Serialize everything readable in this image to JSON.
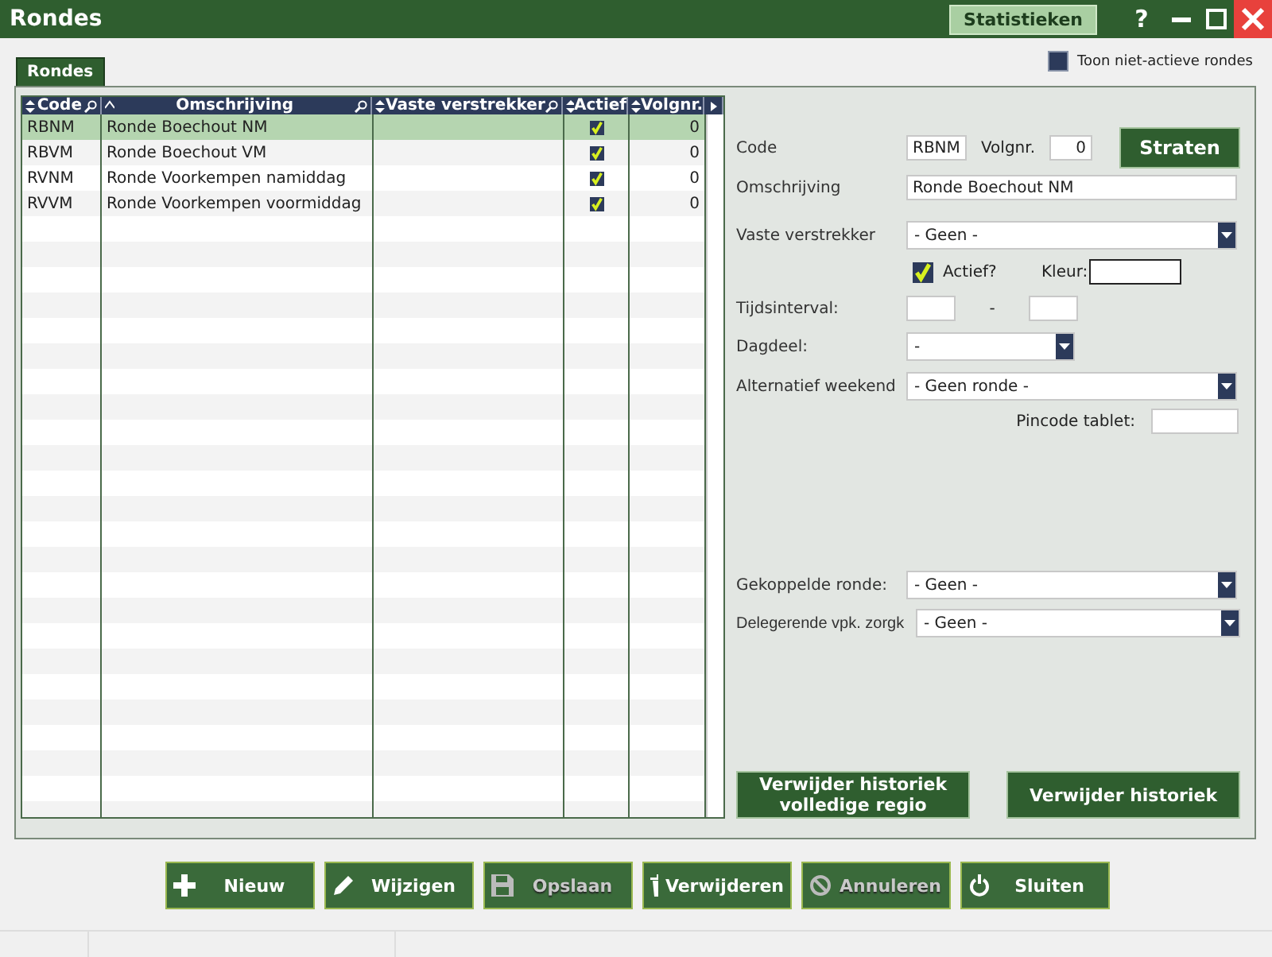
{
  "window": {
    "title": "Rondes",
    "stats_button": "Statistieken",
    "help": "?"
  },
  "tab": {
    "label": "Rondes",
    "selected": true
  },
  "show_inactive": {
    "label": "Toon niet-actieve rondes",
    "checked": false
  },
  "table": {
    "columns": [
      {
        "label": "Code",
        "search": true,
        "sorted": false
      },
      {
        "label": "Omschrijving",
        "search": true,
        "sorted": true
      },
      {
        "label": "Vaste verstrekker",
        "search": true,
        "sorted": false
      },
      {
        "label": "Actief",
        "search": false,
        "sorted": false
      },
      {
        "label": "Volgnr.",
        "search": false,
        "sorted": false
      }
    ],
    "rows": [
      {
        "code": "RBNM",
        "omschrijving": "Ronde Boechout NM",
        "verstrekker": "",
        "actief": true,
        "volgnr": "0",
        "selected": true
      },
      {
        "code": "RBVM",
        "omschrijving": "Ronde Boechout VM",
        "verstrekker": "",
        "actief": true,
        "volgnr": "0",
        "selected": false
      },
      {
        "code": "RVNM",
        "omschrijving": "Ronde Voorkempen namiddag",
        "verstrekker": "",
        "actief": true,
        "volgnr": "0",
        "selected": false
      },
      {
        "code": "RVVM",
        "omschrijving": "Ronde Voorkempen voormiddag",
        "verstrekker": "",
        "actief": true,
        "volgnr": "0",
        "selected": false
      }
    ]
  },
  "form": {
    "code_label": "Code",
    "code": "RBNM",
    "volgnr_label": "Volgnr.",
    "volgnr": "0",
    "straten_button": "Straten",
    "omschrijving_label": "Omschrijving",
    "omschrijving": "Ronde Boechout NM",
    "verstrekker_label": "Vaste verstrekker",
    "verstrekker": "- Geen -",
    "actief_label": "Actief?",
    "actief": true,
    "kleur_label": "Kleur:",
    "tijds_label": "Tijdsinterval:",
    "tijds_sep": "-",
    "dagdeel_label": "Dagdeel:",
    "dagdeel": "-",
    "weekend_label": "Alternatief weekend",
    "weekend": "- Geen ronde -",
    "pincode_label": "Pincode tablet:",
    "gekoppelde_label": "Gekoppelde ronde:",
    "gekoppelde": "- Geen -",
    "delegerende_label": "Delegerende vpk. zorgk",
    "delegerende": "- Geen -",
    "buttons": [
      "Verwijder historiek volledige regio",
      "Verwijder historiek"
    ]
  },
  "actions": [
    {
      "label": "Nieuw",
      "kind": "new",
      "disabled": false
    },
    {
      "label": "Wijzigen",
      "kind": "edit",
      "disabled": false
    },
    {
      "label": "Opslaan",
      "kind": "save",
      "disabled": true
    },
    {
      "label": "Verwijderen",
      "kind": "delete",
      "disabled": false
    },
    {
      "label": "Annuleren",
      "kind": "cancel",
      "disabled": true
    },
    {
      "label": "Sluiten",
      "kind": "close",
      "disabled": false
    }
  ]
}
